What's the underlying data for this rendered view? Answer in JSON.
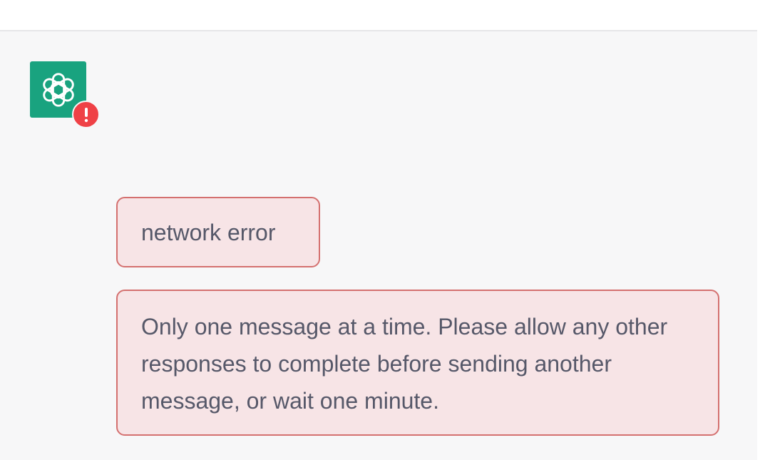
{
  "header": {
    "title": ""
  },
  "assistant": {
    "avatar_icon": "openai-logo-icon",
    "avatar_color": "#19a37f",
    "status_icon": "exclamation-icon",
    "status_color": "#ef4146"
  },
  "messages": [
    {
      "type": "error",
      "text": "network error"
    },
    {
      "type": "error",
      "text": "Only one message at a time. Please allow any other responses to complete before sending another message, or wait one minute."
    }
  ],
  "theme": {
    "error_background": "#f7e4e6",
    "error_border": "#d4706f",
    "text_color": "#565869",
    "page_background": "#f7f7f8"
  }
}
